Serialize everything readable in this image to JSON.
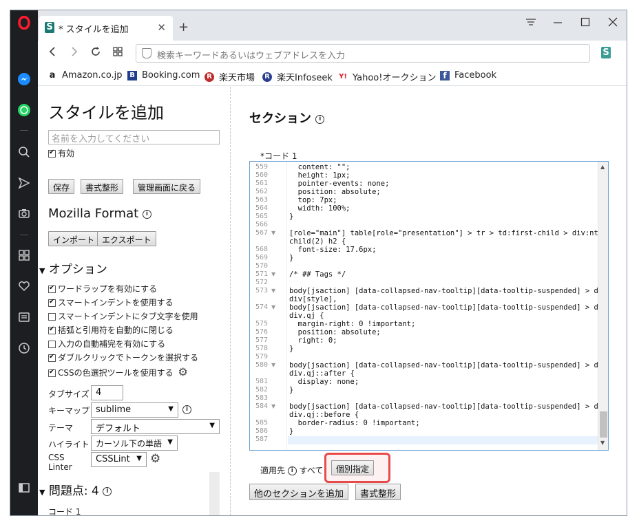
{
  "browser": {
    "tab_title": "* スタイルを追加",
    "tab_favicon": "S",
    "address_placeholder": "検索キーワードあるいはウェブアドレスを入力",
    "ext_icon": "S",
    "bookmarks": [
      {
        "label": "Amazon.co.jp",
        "icon": "a",
        "color": "#222222"
      },
      {
        "label": "Booking.com",
        "icon": "B",
        "color": "#1f3f8c"
      },
      {
        "label": "楽天市場",
        "icon": "R",
        "color": "#bf2b2b"
      },
      {
        "label": "楽天Infoseek",
        "icon": "R",
        "color": "#2a3f8f"
      },
      {
        "label": "Yahoo!オークション",
        "icon": "Y!",
        "color": "#e0202a"
      },
      {
        "label": "Facebook",
        "icon": "f",
        "color": "#3b5998"
      }
    ]
  },
  "left": {
    "title": "スタイルを追加",
    "name_placeholder": "名前を入力してください",
    "enabled_label": "有効",
    "buttons": {
      "save": "保存",
      "format": "書式整形",
      "back": "管理画面に戻る"
    },
    "mozilla_title": "Mozilla Format",
    "import": "インポート",
    "export": "エクスポート",
    "options_title": "オプション",
    "options": [
      {
        "label": "ワードラップを有効にする",
        "checked": true
      },
      {
        "label": "スマートインデントを使用する",
        "checked": true
      },
      {
        "label": "スマートインデントにタブ文字を使用",
        "checked": false
      },
      {
        "label": "括弧と引用符を自動的に閉じる",
        "checked": true
      },
      {
        "label": "入力の自動補完を有効にする",
        "checked": false
      },
      {
        "label": "ダブルクリックでトークンを選択する",
        "checked": true
      },
      {
        "label": "CSSの色選択ツールを使用する",
        "checked": true
      }
    ],
    "tabsize_label": "タブサイズ",
    "tabsize_value": "4",
    "keymap_label": "キーマップ",
    "keymap_value": "sublime",
    "theme_label": "テーマ",
    "theme_value": "デフォルト",
    "highlight_label": "ハイライト",
    "highlight_value": "カーソル下の単語",
    "linter_label_1": "CSS",
    "linter_label_2": "Linter",
    "linter_value": "CSSLint",
    "issues_title": "問題点: 4",
    "issues_code": "コード 1"
  },
  "right": {
    "section_title": "セクション",
    "code_label": "*コード 1",
    "lines": [
      {
        "n": "559",
        "t": "  content: \"\";"
      },
      {
        "n": "560",
        "t": "  height: 1px;"
      },
      {
        "n": "561",
        "t": "  pointer-events: none;"
      },
      {
        "n": "562",
        "t": "  position: absolute;"
      },
      {
        "n": "563",
        "t": "  top: 7px;"
      },
      {
        "n": "564",
        "t": "  width: 100%;"
      },
      {
        "n": "565",
        "t": "}"
      },
      {
        "n": "566",
        "t": ""
      },
      {
        "n": "567",
        "t": "[role=\"main\"] table[role=\"presentation\"] > tr > td:first-child > div:nth-",
        "fold": true
      },
      {
        "n": "",
        "t": "child(2) h2 {"
      },
      {
        "n": "568",
        "t": "  font-size: 17.6px;"
      },
      {
        "n": "569",
        "t": "}"
      },
      {
        "n": "570",
        "t": ""
      },
      {
        "n": "571",
        "t": "/* ## Tags */",
        "fold": true
      },
      {
        "n": "572",
        "t": ""
      },
      {
        "n": "573",
        "t": "body[jsaction] [data-collapsed-nav-tooltip][data-tooltip-suspended] > div",
        "fold": true
      },
      {
        "n": "",
        "t": "div[style],"
      },
      {
        "n": "574",
        "t": "body[jsaction] [data-collapsed-nav-tooltip][data-tooltip-suspended] > div",
        "fold": true
      },
      {
        "n": "",
        "t": "div.qj {"
      },
      {
        "n": "575",
        "t": "  margin-right: 0 !important;"
      },
      {
        "n": "576",
        "t": "  position: absolute;"
      },
      {
        "n": "577",
        "t": "  right: 0;"
      },
      {
        "n": "578",
        "t": "}"
      },
      {
        "n": "579",
        "t": ""
      },
      {
        "n": "580",
        "t": "body[jsaction] [data-collapsed-nav-tooltip][data-tooltip-suspended] > div",
        "fold": true
      },
      {
        "n": "",
        "t": "div.qj::after {"
      },
      {
        "n": "581",
        "t": "  display: none;"
      },
      {
        "n": "582",
        "t": "}"
      },
      {
        "n": "583",
        "t": ""
      },
      {
        "n": "584",
        "t": "body[jsaction] [data-collapsed-nav-tooltip][data-tooltip-suspended] > div",
        "fold": true
      },
      {
        "n": "",
        "t": "div.qj::before {"
      },
      {
        "n": "585",
        "t": "  border-radius: 0 !important;"
      },
      {
        "n": "586",
        "t": "}"
      },
      {
        "n": "587",
        "t": ""
      }
    ],
    "apply_label": "適用先",
    "apply_all": "すべて",
    "specify_button": "個別指定",
    "add_section_button": "他のセクションを追加",
    "format_button": "書式整形"
  },
  "colors": {
    "highlight": "#e84a4a",
    "opera_red": "#ff1b2d",
    "messenger": "#1a8cff",
    "whatsapp": "#25d366"
  }
}
